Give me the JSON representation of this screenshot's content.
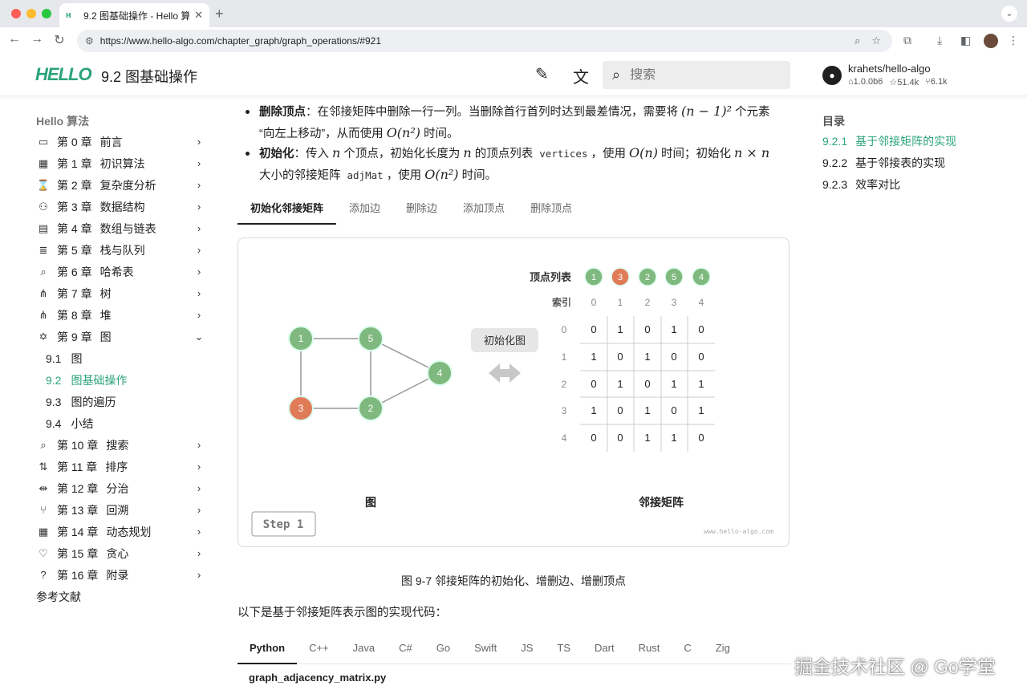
{
  "browser": {
    "tab_title": "9.2 图基础操作 - Hello 算法",
    "url": "https://www.hello-algo.com/chapter_graph/graph_operations/#921"
  },
  "header": {
    "logo": "HELLO",
    "title": "9.2 图基础操作",
    "search_placeholder": "搜索",
    "repo": "krahets/hello-algo",
    "version": "1.0.0b6",
    "stars": "51.4k",
    "forks": "6.1k"
  },
  "sidebar": {
    "heading": "Hello 算法",
    "chapters": [
      {
        "num": "第 0 章",
        "label": "前言",
        "icon": "▭"
      },
      {
        "num": "第 1 章",
        "label": "初识算法",
        "icon": "▦"
      },
      {
        "num": "第 2 章",
        "label": "复杂度分析",
        "icon": "⌛"
      },
      {
        "num": "第 3 章",
        "label": "数据结构",
        "icon": "⚇"
      },
      {
        "num": "第 4 章",
        "label": "数组与链表",
        "icon": "▤"
      },
      {
        "num": "第 5 章",
        "label": "栈与队列",
        "icon": "≣"
      },
      {
        "num": "第 6 章",
        "label": "哈希表",
        "icon": "⌕"
      },
      {
        "num": "第 7 章",
        "label": "树",
        "icon": "⋔"
      },
      {
        "num": "第 8 章",
        "label": "堆",
        "icon": "⋔"
      },
      {
        "num": "第 9 章",
        "label": "图",
        "icon": "✡"
      }
    ],
    "subitems": [
      {
        "num": "9.1",
        "label": "图"
      },
      {
        "num": "9.2",
        "label": "图基础操作"
      },
      {
        "num": "9.3",
        "label": "图的遍历"
      },
      {
        "num": "9.4",
        "label": "小结"
      }
    ],
    "chapters2": [
      {
        "num": "第 10 章",
        "label": "搜索",
        "icon": "⌕"
      },
      {
        "num": "第 11 章",
        "label": "排序",
        "icon": "⇅"
      },
      {
        "num": "第 12 章",
        "label": "分治",
        "icon": "⇹"
      },
      {
        "num": "第 13 章",
        "label": "回溯",
        "icon": "⑂"
      },
      {
        "num": "第 14 章",
        "label": "动态规划",
        "icon": "▦"
      },
      {
        "num": "第 15 章",
        "label": "贪心",
        "icon": "♡"
      },
      {
        "num": "第 16 章",
        "label": "附录",
        "icon": "?"
      }
    ],
    "references": "参考文献"
  },
  "toc": {
    "title": "目录",
    "items": [
      {
        "num": "9.2.1",
        "label": "基于邻接矩阵的实现"
      },
      {
        "num": "9.2.2",
        "label": "基于邻接表的实现"
      },
      {
        "num": "9.2.3",
        "label": "效率对比"
      }
    ]
  },
  "content": {
    "bullet1_label": "删除顶点",
    "bullet1_text_a": "：在邻接矩阵中删除一行一列。当删除首行首列时达到最差情况，需要将 ",
    "bullet1_math_a": "(n − 1)²",
    "bullet1_text_b": " 个元素",
    "bullet1_text_c": "“向左上移动”，从而使用 ",
    "bullet1_math_b": "O(n²)",
    "bullet1_text_d": " 时间。",
    "bullet2_label": "初始化",
    "bullet2_text_a": "：传入 ",
    "bullet2_math_a": "n",
    "bullet2_text_b": " 个顶点，初始化长度为 ",
    "bullet2_math_b": "n",
    "bullet2_text_c": " 的顶点列表 ",
    "bullet2_code_a": "vertices",
    "bullet2_text_d": "，使用 ",
    "bullet2_math_c": "O(n)",
    "bullet2_text_e": " 时间；初始化 ",
    "bullet2_math_d": "n × n",
    "bullet2_text_f": "大小的邻接矩阵 ",
    "bullet2_code_b": "adjMat",
    "bullet2_text_g": "，使用 ",
    "bullet2_math_e": "O(n²)",
    "bullet2_text_h": " 时间。",
    "fig_tabs": [
      "初始化邻接矩阵",
      "添加边",
      "删除边",
      "添加顶点",
      "删除顶点"
    ],
    "caption": "图 9-7   邻接矩阵的初始化、增删边、增删顶点",
    "para": "以下是基于邻接矩阵表示图的实现代码：",
    "code_tabs": [
      "Python",
      "C++",
      "Java",
      "C#",
      "Go",
      "Swift",
      "JS",
      "TS",
      "Dart",
      "Rust",
      "C",
      "Zig"
    ],
    "code_file": "graph_adjacency_matrix.py"
  },
  "figure": {
    "graph_label": "图",
    "matrix_label": "邻接矩阵",
    "action_label": "初始化图",
    "vertex_list_label": "顶点列表",
    "index_label": "索引",
    "step_label": "Step 1",
    "site_mark": "www.hello-algo.com",
    "vertices": [
      "1",
      "3",
      "2",
      "5",
      "4"
    ],
    "indices": [
      "0",
      "1",
      "2",
      "3",
      "4"
    ],
    "matrix": [
      [
        0,
        1,
        0,
        1,
        0
      ],
      [
        1,
        0,
        1,
        0,
        0
      ],
      [
        0,
        1,
        0,
        1,
        1
      ],
      [
        1,
        0,
        1,
        0,
        1
      ],
      [
        0,
        0,
        1,
        1,
        0
      ]
    ],
    "graph_nodes": [
      "1",
      "5",
      "4",
      "3",
      "2"
    ],
    "colors": {
      "green": "#7fb97f",
      "orange": "#e07b58",
      "accent": "#2ba37b"
    }
  },
  "watermark": "掘金技术社区 @ Go学堂"
}
